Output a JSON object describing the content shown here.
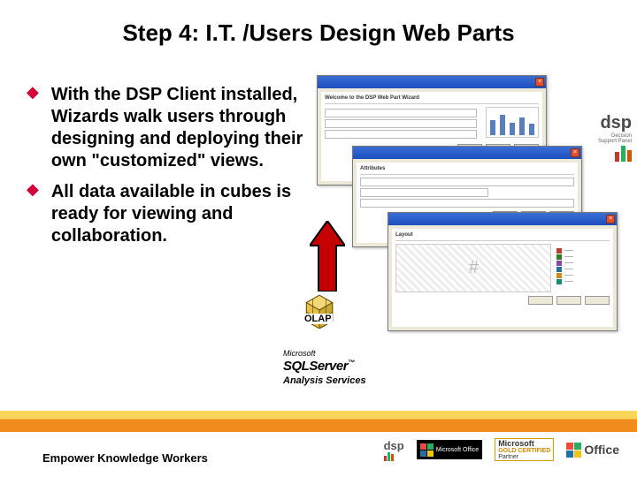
{
  "title": "Step 4: I.T. /Users Design Web Parts",
  "bullets": [
    "With the DSP Client installed, Wizards walk users through designing and deploying their own \"customized\" views.",
    "All data available in cubes is ready for viewing and collaboration."
  ],
  "olap_label": "OLAP",
  "sql": {
    "brand_prefix": "Microsoft",
    "product": "SQLServer",
    "subline": "Analysis Services"
  },
  "dsp": {
    "name": "dsp",
    "tagline1": "Decision",
    "tagline2": "Support Panel"
  },
  "wizard_windows": {
    "w1_heading": "Welcome to the DSP Web Part Wizard",
    "w2_heading": "Attributes",
    "w3_heading": "Layout"
  },
  "footer_tag": "Empower Knowledge Workers",
  "footer": {
    "dsp": "dsp",
    "office_small": "Microsoft Office",
    "gold1": "Microsoft",
    "gold2": "GOLD CERTIFIED",
    "gold3": "Partner",
    "office_big": "Office"
  }
}
